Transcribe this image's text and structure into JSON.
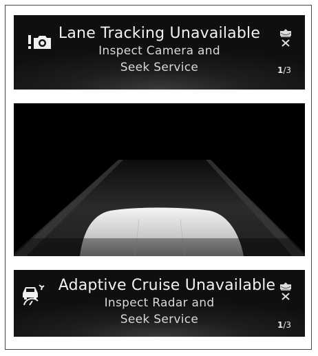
{
  "alerts": [
    {
      "title": "Lane Tracking Unavailable",
      "line1": "Inspect Camera and",
      "line2": "Seek Service",
      "page_current": "1",
      "page_total": "/3",
      "icon": "camera-warning-icon"
    },
    {
      "title": "Adaptive Cruise Unavailable",
      "line1": "Inspect Radar and",
      "line2": "Seek Service",
      "page_current": "1",
      "page_total": "/3",
      "icon": "radar-car-warning-icon"
    }
  ],
  "mute_icon": "mute-alert-icon",
  "road_view": "camera-road-view",
  "colors": {
    "panel_bg": "#111111",
    "text": "#f2f2f2",
    "road": "#2a2a2a"
  }
}
